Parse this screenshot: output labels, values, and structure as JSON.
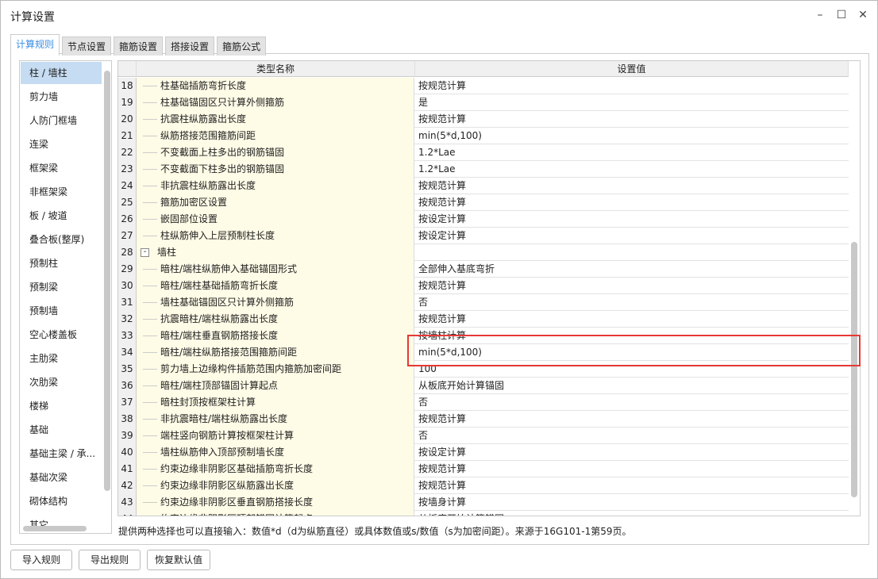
{
  "window": {
    "title": "计算设置",
    "minimize": "–",
    "maximize": "☐",
    "close": "✕"
  },
  "tabs": [
    "计算规则",
    "节点设置",
    "箍筋设置",
    "搭接设置",
    "箍筋公式"
  ],
  "sidebar": [
    "柱 / 墙柱",
    "剪力墙",
    "人防门框墙",
    "连梁",
    "框架梁",
    "非框架梁",
    "板 / 坡道",
    "叠合板(整厚)",
    "预制柱",
    "预制梁",
    "预制墙",
    "空心楼盖板",
    "主肋梁",
    "次肋梁",
    "楼梯",
    "基础",
    "基础主梁 / 承...",
    "基础次梁",
    "砌体结构",
    "其它"
  ],
  "table": {
    "headers": [
      "类型名称",
      "设置值"
    ],
    "rows": [
      [
        "18",
        "柱基础插筋弯折长度",
        "按规范计算"
      ],
      [
        "19",
        "柱基础锚固区只计算外侧箍筋",
        "是"
      ],
      [
        "20",
        "抗震柱纵筋露出长度",
        "按规范计算"
      ],
      [
        "21",
        "纵筋搭接范围箍筋间距",
        "min(5*d,100)"
      ],
      [
        "22",
        "不变截面上柱多出的钢筋锚固",
        "1.2*Lae"
      ],
      [
        "23",
        "不变截面下柱多出的钢筋锚固",
        "1.2*Lae"
      ],
      [
        "24",
        "非抗震柱纵筋露出长度",
        "按规范计算"
      ],
      [
        "25",
        "箍筋加密区设置",
        "按规范计算"
      ],
      [
        "26",
        "嵌固部位设置",
        "按设定计算"
      ],
      [
        "27",
        "柱纵筋伸入上层预制柱长度",
        "按设定计算"
      ],
      [
        "28",
        "墙柱",
        ""
      ],
      [
        "29",
        "暗柱/端柱纵筋伸入基础锚固形式",
        "全部伸入基底弯折"
      ],
      [
        "30",
        "暗柱/端柱基础插筋弯折长度",
        "按规范计算"
      ],
      [
        "31",
        "墙柱基础锚固区只计算外侧箍筋",
        "否"
      ],
      [
        "32",
        "抗震暗柱/端柱纵筋露出长度",
        "按规范计算"
      ],
      [
        "33",
        "暗柱/端柱垂直钢筋搭接长度",
        "按墙柱计算"
      ],
      [
        "34",
        "暗柱/端柱纵筋搭接范围箍筋间距",
        "min(5*d,100)"
      ],
      [
        "35",
        "剪力墙上边缘构件插筋范围内箍筋加密间距",
        "100"
      ],
      [
        "36",
        "暗柱/端柱顶部锚固计算起点",
        "从板底开始计算锚固"
      ],
      [
        "37",
        "暗柱封顶按框架柱计算",
        "否"
      ],
      [
        "38",
        "非抗震暗柱/端柱纵筋露出长度",
        "按规范计算"
      ],
      [
        "39",
        "端柱竖向钢筋计算按框架柱计算",
        "否"
      ],
      [
        "40",
        "墙柱纵筋伸入顶部预制墙长度",
        "按设定计算"
      ],
      [
        "41",
        "约束边缘非阴影区基础插筋弯折长度",
        "按规范计算"
      ],
      [
        "42",
        "约束边缘非阴影区纵筋露出长度",
        "按规范计算"
      ],
      [
        "43",
        "约束边缘非阴影区垂直钢筋搭接长度",
        "按墙身计算"
      ],
      [
        "44",
        "约束边缘非阴影区顶部锚固计算起点",
        "从板底开始计算锚固"
      ]
    ]
  },
  "group_expander": "-",
  "hint": "提供两种选择也可以直接输入：数值*d（d为纵筋直径）或具体数值或s/数值（s为加密间距）。来源于16G101-1第59页。",
  "buttons": [
    "导入规则",
    "导出规则",
    "恢复默认值"
  ],
  "highlight_color": "#e53935"
}
